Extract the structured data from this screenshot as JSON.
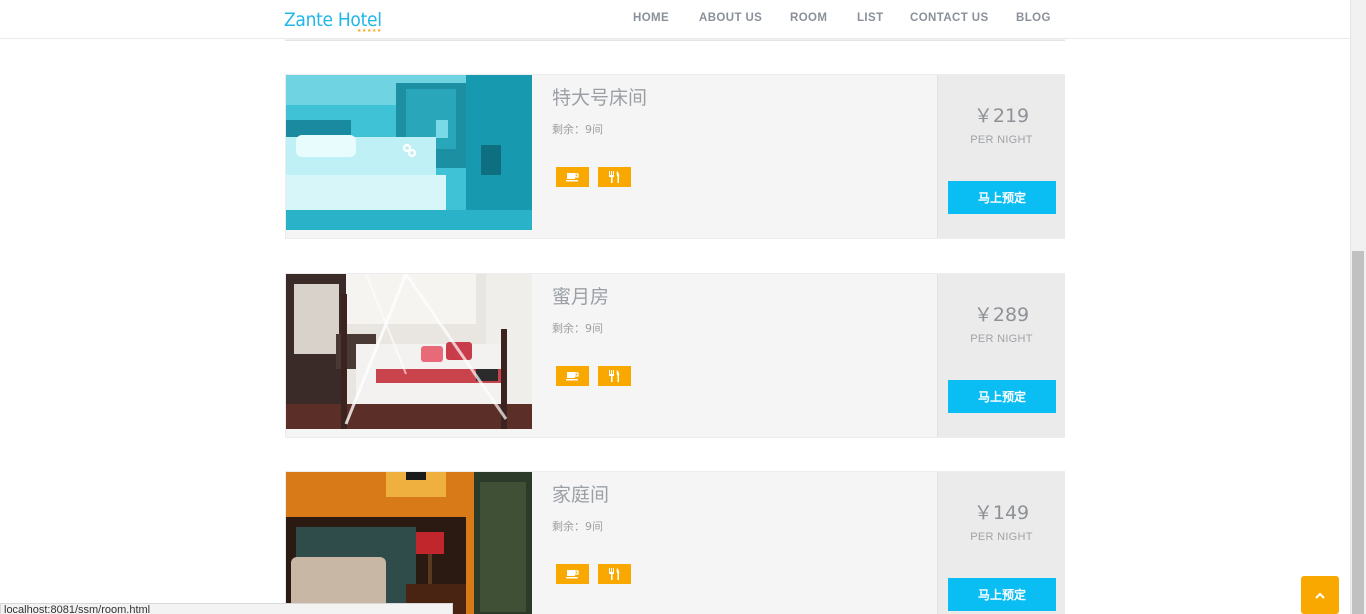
{
  "brand": {
    "name": "Zante Hotel",
    "stars": "★★★★★"
  },
  "nav": [
    "HOME",
    "ABOUT US",
    "ROOM",
    "LIST",
    "CONTACT US",
    "BLOG"
  ],
  "rooms": [
    {
      "title": "特大号床间",
      "stock": "剩余：9间",
      "price": "￥219",
      "per_night": "PER NIGHT",
      "book_label": "马上预定",
      "amenities": [
        "coffee-icon",
        "restaurant-icon"
      ]
    },
    {
      "title": "蜜月房",
      "stock": "剩余：9间",
      "price": "￥289",
      "per_night": "PER NIGHT",
      "book_label": "马上预定",
      "amenities": [
        "coffee-icon",
        "restaurant-icon"
      ]
    },
    {
      "title": "家庭间",
      "stock": "剩余：9间",
      "price": "￥149",
      "per_night": "PER NIGHT",
      "book_label": "马上预定",
      "amenities": [
        "coffee-icon",
        "restaurant-icon"
      ]
    }
  ],
  "status_url": "localhost:8081/ssm/room.html",
  "colors": {
    "brand": "#1fb6e8",
    "accent": "#f9a800",
    "button": "#0abdf3"
  }
}
